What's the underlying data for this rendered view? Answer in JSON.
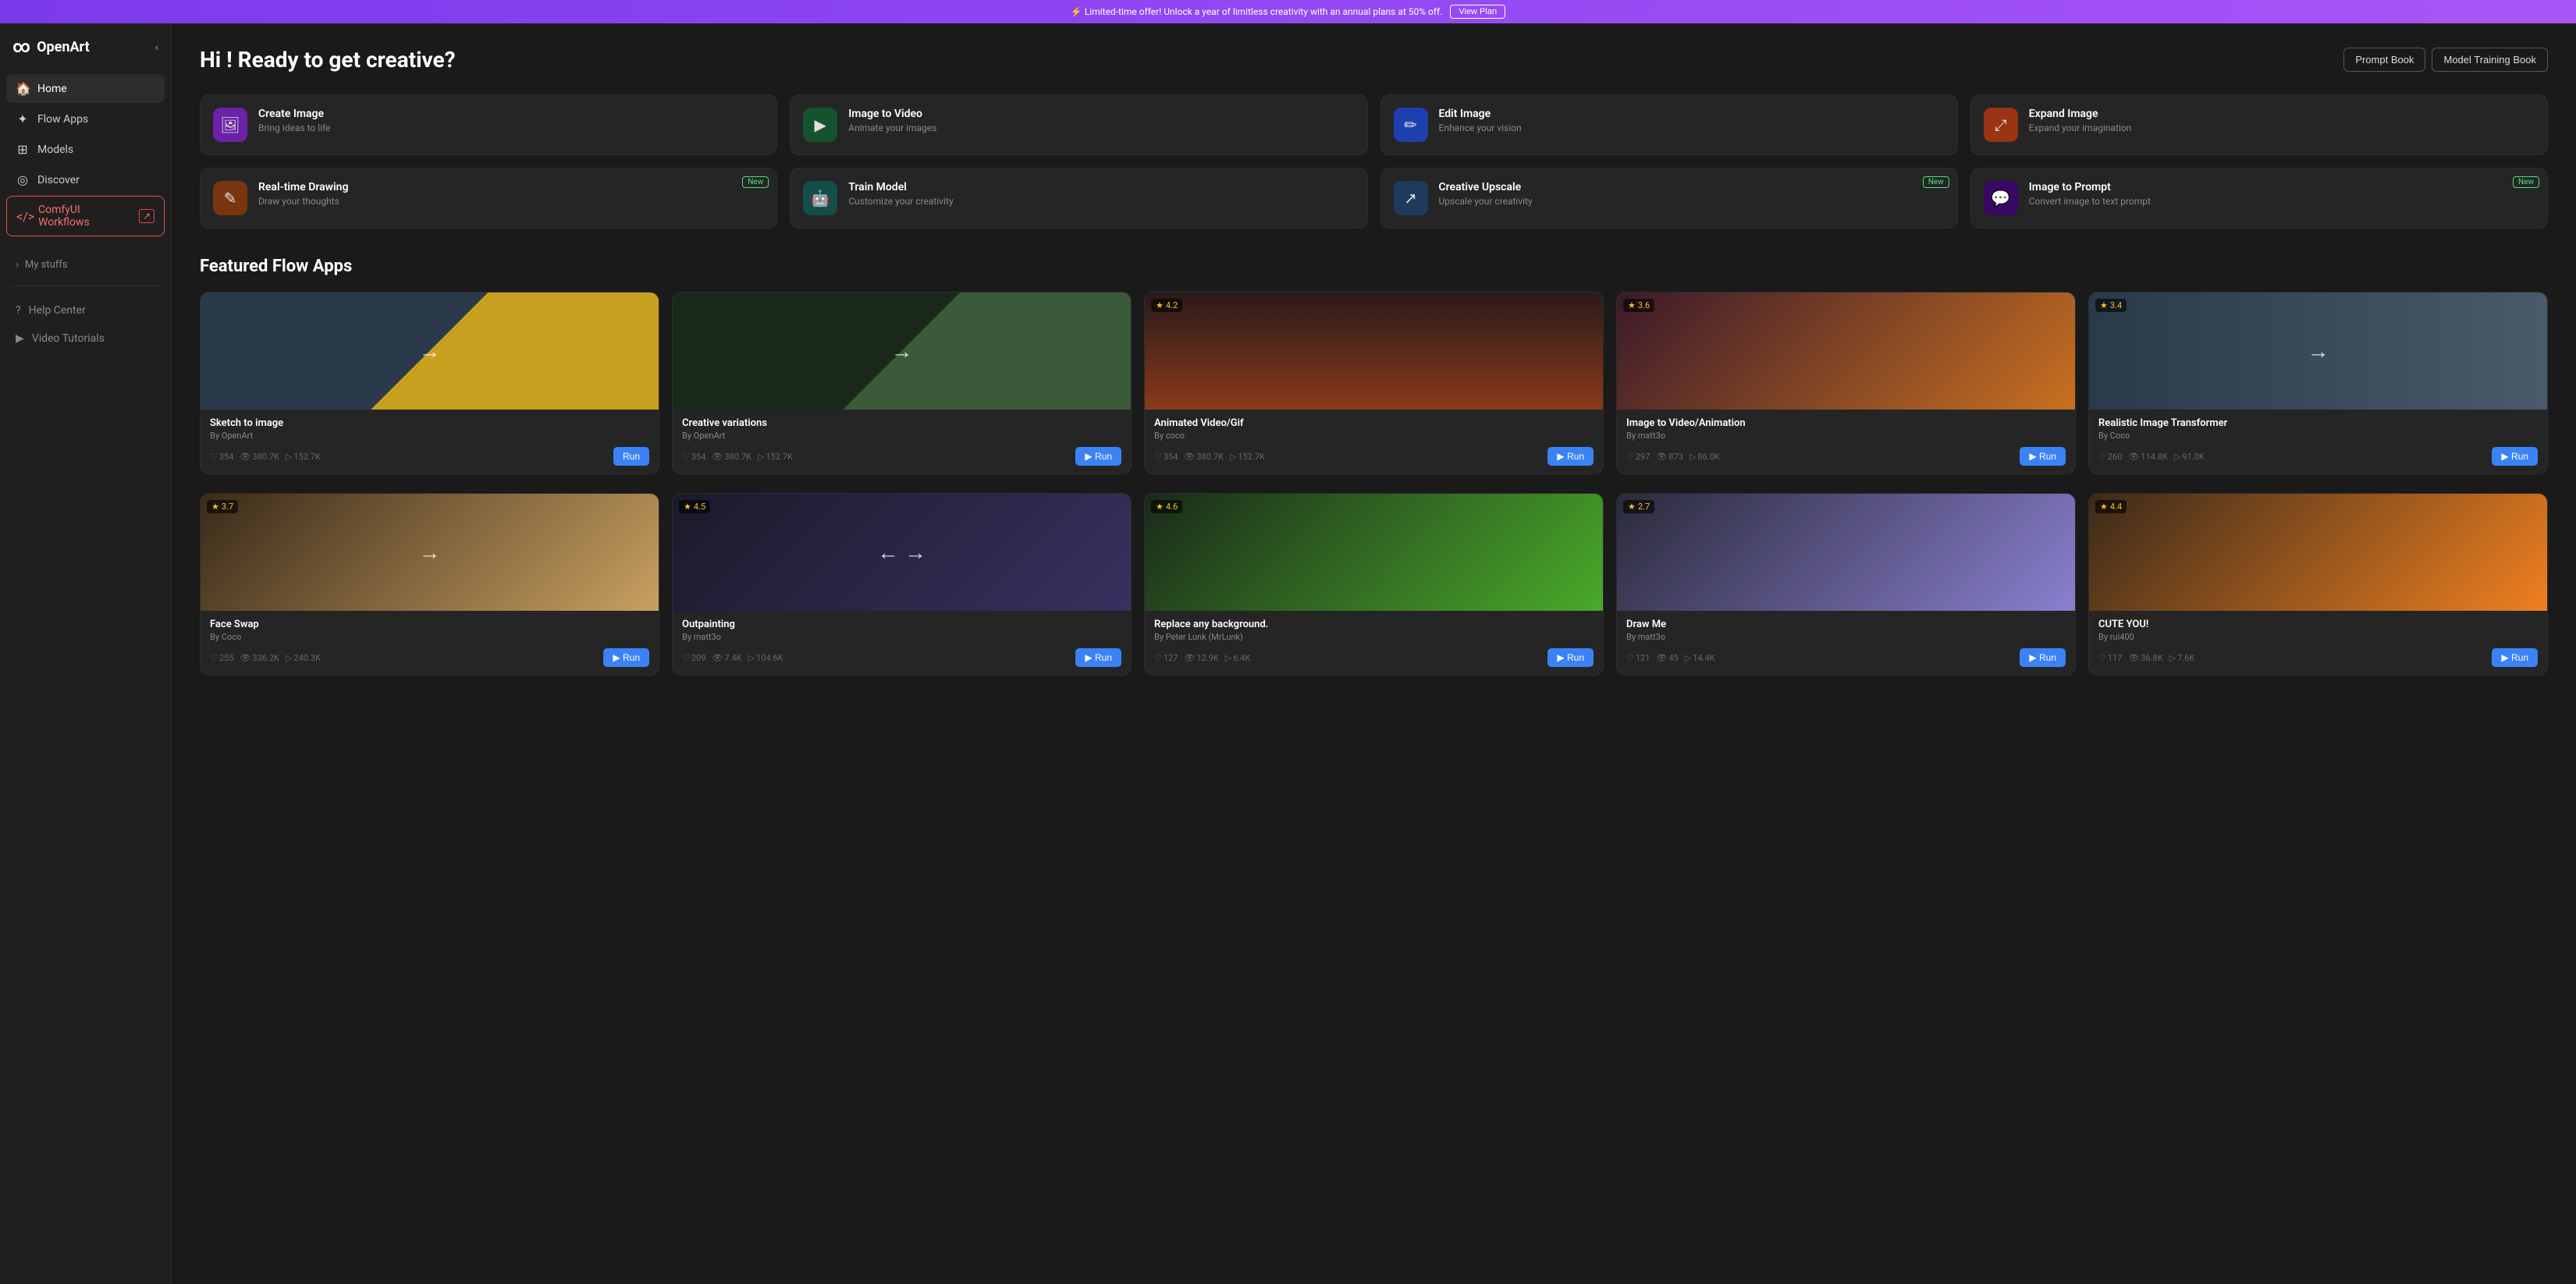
{
  "banner": {
    "text": "⚡ Limited-time offer! Unlock a year of limitless creativity with an annual plans at 50% off.",
    "button": "View Plan"
  },
  "sidebar": {
    "logo": "OpenArt",
    "items": [
      {
        "id": "home",
        "label": "Home",
        "icon": "🏠",
        "active": true
      },
      {
        "id": "flow-apps",
        "label": "Flow Apps",
        "icon": "✦"
      },
      {
        "id": "models",
        "label": "Models",
        "icon": "⊞"
      },
      {
        "id": "discover",
        "label": "Discover",
        "icon": "◎"
      },
      {
        "id": "comfy",
        "label": "ComfyUI Workflows",
        "icon": "</>",
        "special": true
      }
    ],
    "my_stuffs": "My stuffs",
    "bottom_items": [
      {
        "id": "help",
        "label": "Help Center",
        "icon": "?"
      },
      {
        "id": "tutorials",
        "label": "Video Tutorials",
        "icon": "▶"
      }
    ]
  },
  "header": {
    "title": "Hi ! Ready to get creative?",
    "buttons": [
      "Prompt Book",
      "Model Training Book"
    ]
  },
  "features": [
    {
      "id": "create-image",
      "title": "Create Image",
      "desc": "Bring ideas to life",
      "icon": "🖼",
      "color": "purple",
      "new": false
    },
    {
      "id": "image-to-video",
      "title": "Image to Video",
      "desc": "Animate your images",
      "icon": "▶",
      "color": "green-dark",
      "new": false
    },
    {
      "id": "edit-image",
      "title": "Edit Image",
      "desc": "Enhance your vision",
      "icon": "✏",
      "color": "blue",
      "new": false
    },
    {
      "id": "expand-image",
      "title": "Expand Image",
      "desc": "Expand your imagination",
      "icon": "⤢",
      "color": "orange",
      "new": false
    },
    {
      "id": "realtime-drawing",
      "title": "Real-time Drawing",
      "desc": "Draw your thoughts",
      "icon": "✎",
      "color": "amber",
      "new": true
    },
    {
      "id": "train-model",
      "title": "Train Model",
      "desc": "Customize your creativity",
      "icon": "🤖",
      "color": "teal",
      "new": false
    },
    {
      "id": "creative-upscale",
      "title": "Creative Upscale",
      "desc": "Upscale your creativity",
      "icon": "↗",
      "color": "blue2",
      "new": true
    },
    {
      "id": "image-to-prompt",
      "title": "Image to Prompt",
      "desc": "Convert image to text prompt",
      "icon": "💬",
      "color": "violet",
      "new": true
    }
  ],
  "featured_section": {
    "title": "Featured Flow Apps"
  },
  "apps_row1": [
    {
      "id": "sketch-to-image",
      "title": "Sketch to image",
      "author": "By OpenArt",
      "rating": null,
      "img_class": "img-sketch",
      "has_arrow": true,
      "stats": {
        "likes": "354",
        "views": "380.7K",
        "runs": "152.7K"
      }
    },
    {
      "id": "creative-variations",
      "title": "Creative variations",
      "author": "By OpenArt",
      "rating": null,
      "img_class": "img-chairs",
      "has_arrow": true,
      "stats": {
        "likes": "354",
        "views": "380.7K",
        "runs": "152.7K"
      }
    },
    {
      "id": "animated-video-gif",
      "title": "Animated Video/Gif",
      "author": "By coco",
      "rating": "4.2",
      "img_class": "img-animated",
      "has_arrow": false,
      "stats": {
        "likes": "354",
        "views": "380.7K",
        "runs": "152.7K"
      }
    },
    {
      "id": "image-to-video-animation",
      "title": "Image to Video/Animation",
      "author": "By matt3o",
      "rating": "3.6",
      "img_class": "img-i2v",
      "has_arrow": false,
      "stats": {
        "likes": "297",
        "views": "873",
        "runs": "86.0K"
      }
    },
    {
      "id": "realistic-image-transformer",
      "title": "Realistic Image Transformer",
      "author": "By Coco",
      "rating": "3.4",
      "img_class": "img-realistic",
      "has_arrow": true,
      "stats": {
        "likes": "260",
        "views": "114.8K",
        "runs": "91.0K"
      }
    }
  ],
  "apps_row2": [
    {
      "id": "face-swap",
      "title": "Face Swap",
      "author": "By Coco",
      "rating": "3.7",
      "img_class": "img-faceswap",
      "has_arrow": true,
      "stats": {
        "likes": "255",
        "views": "336.2K",
        "runs": "240.3K"
      }
    },
    {
      "id": "outpainting",
      "title": "Outpainting",
      "author": "By matt3o",
      "rating": "4.5",
      "img_class": "img-outpainting",
      "has_arrow": true,
      "stats": {
        "likes": "209",
        "views": "7.4K",
        "runs": "104.6K"
      }
    },
    {
      "id": "replace-background",
      "title": "Replace any background.",
      "author": "By Peter Lunk (MrLunk)",
      "rating": "4.6",
      "img_class": "img-replace",
      "has_arrow": false,
      "stats": {
        "likes": "127",
        "views": "12.9K",
        "runs": "6.4K"
      }
    },
    {
      "id": "draw-me",
      "title": "Draw Me",
      "author": "By matt3o",
      "rating": "2.7",
      "img_class": "img-drawme",
      "has_arrow": false,
      "stats": {
        "likes": "121",
        "views": "45",
        "runs": "14.4K"
      }
    },
    {
      "id": "cute-you",
      "title": "CUTE YOU!",
      "author": "By rui400",
      "rating": "4.4",
      "img_class": "img-cute",
      "has_arrow": false,
      "stats": {
        "likes": "117",
        "views": "36.8K",
        "runs": "7.6K"
      }
    }
  ],
  "run_button_label": "Run"
}
